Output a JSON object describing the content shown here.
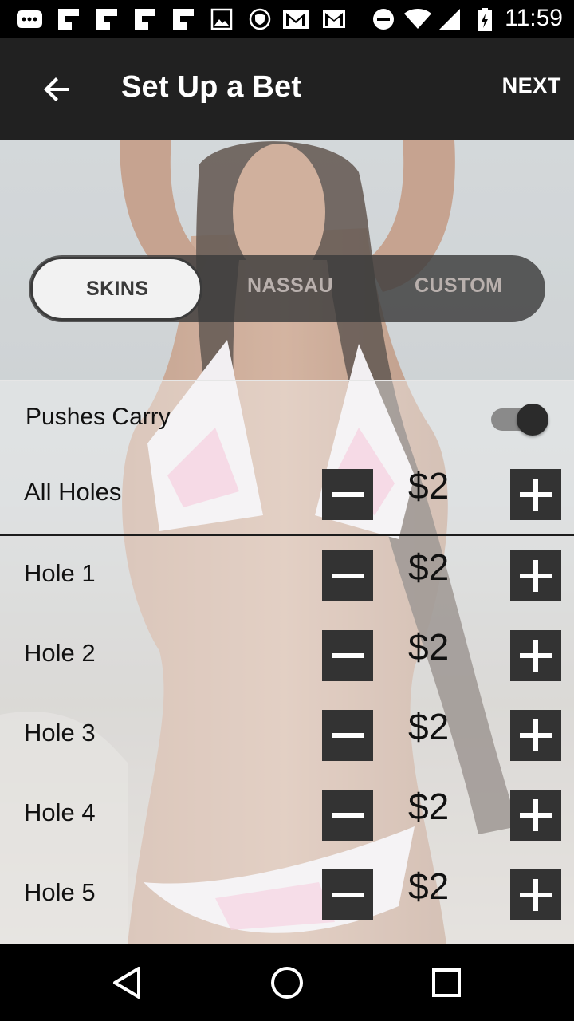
{
  "status_bar": {
    "time": "11:59",
    "icons": [
      "chat-icon",
      "flipboard-icon",
      "flipboard-icon",
      "flipboard-icon",
      "flipboard-icon",
      "image-icon",
      "shield-icon",
      "gmail-icon",
      "gmail-icon",
      "do-not-disturb-icon",
      "wifi-icon",
      "signal-icon",
      "battery-icon"
    ]
  },
  "app_bar": {
    "title": "Set Up a Bet",
    "next_label": "NEXT"
  },
  "tabs": [
    {
      "label": "SKINS",
      "selected": true
    },
    {
      "label": "NASSAU",
      "selected": false
    },
    {
      "label": "CUSTOM",
      "selected": false
    }
  ],
  "settings": {
    "pushes_carry_label": "Pushes Carry",
    "pushes_carry_on": true
  },
  "all_holes": {
    "label": "All Holes",
    "amount": "$2"
  },
  "holes": [
    {
      "label": "Hole 1",
      "amount": "$2"
    },
    {
      "label": "Hole 2",
      "amount": "$2"
    },
    {
      "label": "Hole 3",
      "amount": "$2"
    },
    {
      "label": "Hole 4",
      "amount": "$2"
    },
    {
      "label": "Hole 5",
      "amount": "$2"
    }
  ],
  "colors": {
    "app_bar": "#212121",
    "step_button": "#333333",
    "status_bar": "#000000"
  }
}
